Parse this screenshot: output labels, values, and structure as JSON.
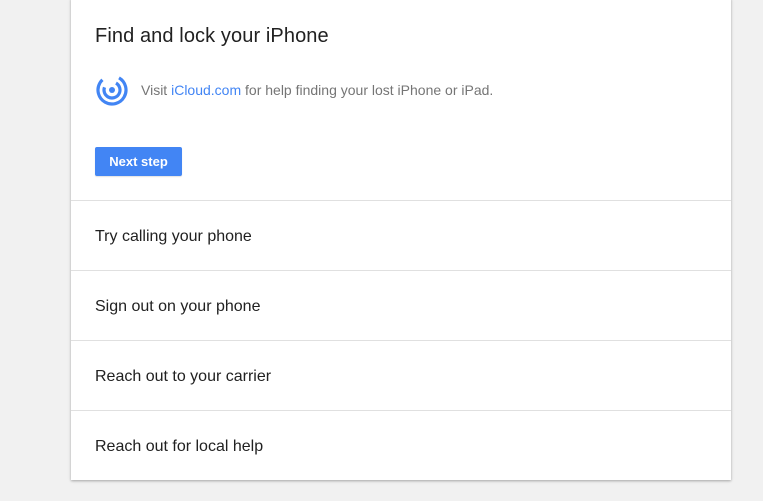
{
  "card": {
    "title": "Find and lock your iPhone",
    "help": {
      "icon": "find-device-radar-icon",
      "prefix": "Visit ",
      "link": "iCloud.com",
      "suffix": " for help finding your lost iPhone or iPad."
    },
    "next_label": "Next step"
  },
  "options": [
    {
      "label": "Try calling your phone"
    },
    {
      "label": "Sign out on your phone"
    },
    {
      "label": "Reach out to your carrier"
    },
    {
      "label": "Reach out for local help"
    }
  ],
  "colors": {
    "accent": "#4285f4",
    "background": "#f1f1f1",
    "card": "#ffffff",
    "divider": "#e0e0e0"
  }
}
